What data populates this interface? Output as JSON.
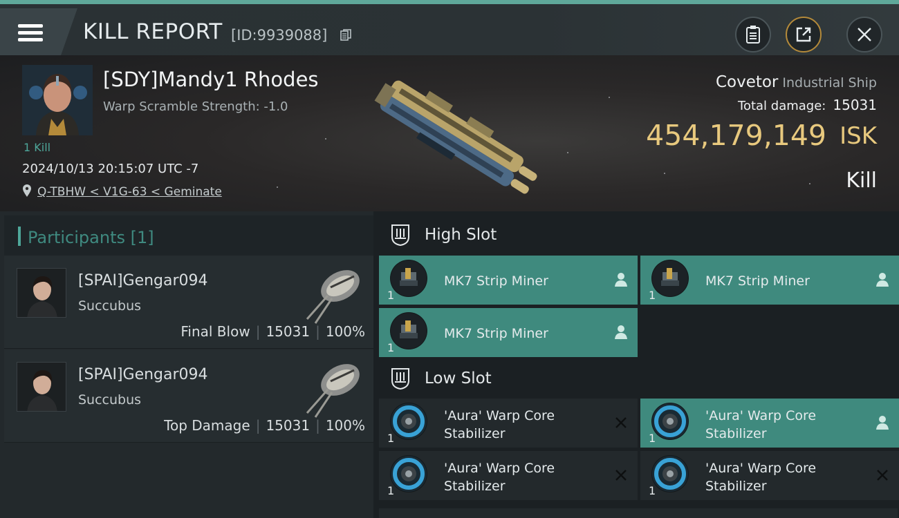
{
  "header": {
    "title": "KILL REPORT",
    "report_id": "[ID:9939088]",
    "icons": [
      "menu-icon",
      "copy-icon",
      "clipboard-icon",
      "share-icon",
      "close-icon"
    ]
  },
  "victim": {
    "name": "[SDY]Mandy1 Rhodes",
    "warp_scramble": "Warp Scramble Strength: -1.0",
    "kill_count": "1 Kill",
    "timestamp": "2024/10/13 20:15:07 UTC -7",
    "location": "Q-TBHW < V1G-63 < Geminate",
    "ship_name": "Covetor",
    "ship_class": "Industrial Ship",
    "total_damage_label": "Total damage:",
    "total_damage": "15031",
    "isk_value": "454,179,149",
    "isk_unit": "ISK",
    "result": "Kill"
  },
  "participants": {
    "title": "Participants [1]",
    "items": [
      {
        "name": "[SPAI]Gengar094",
        "ship": "Succubus",
        "role": "Final Blow",
        "damage": "15031",
        "percent": "100%"
      },
      {
        "name": "[SPAI]Gengar094",
        "ship": "Succubus",
        "role": "Top Damage",
        "damage": "15031",
        "percent": "100%"
      }
    ]
  },
  "fittings": {
    "high_slot": {
      "title": "High Slot",
      "modules": [
        {
          "name": "MK7 Strip Miner",
          "qty": "1",
          "status": "dropped",
          "status_icon": "person-icon"
        },
        {
          "name": "MK7 Strip Miner",
          "qty": "1",
          "status": "dropped",
          "status_icon": "person-icon"
        },
        {
          "name": "MK7 Strip Miner",
          "qty": "1",
          "status": "dropped",
          "status_icon": "person-icon"
        }
      ]
    },
    "low_slot": {
      "title": "Low Slot",
      "modules": [
        {
          "name_line1": "'Aura' Warp Core",
          "name_line2": "Stabilizer",
          "qty": "1",
          "status": "destroyed",
          "status_icon": "x-icon"
        },
        {
          "name_line1": "'Aura' Warp Core",
          "name_line2": "Stabilizer",
          "qty": "1",
          "status": "dropped",
          "status_icon": "person-icon"
        },
        {
          "name_line1": "'Aura' Warp Core",
          "name_line2": "Stabilizer",
          "qty": "1",
          "status": "destroyed",
          "status_icon": "x-icon"
        },
        {
          "name_line1": "'Aura' Warp Core",
          "name_line2": "Stabilizer",
          "qty": "1",
          "status": "destroyed",
          "status_icon": "x-icon"
        }
      ]
    }
  },
  "colors": {
    "accent_teal": "#4ea79a",
    "dropped_bg": "#3f8a7e",
    "isk_gold": "#e8c97e",
    "share_ring": "#b48a3a"
  }
}
